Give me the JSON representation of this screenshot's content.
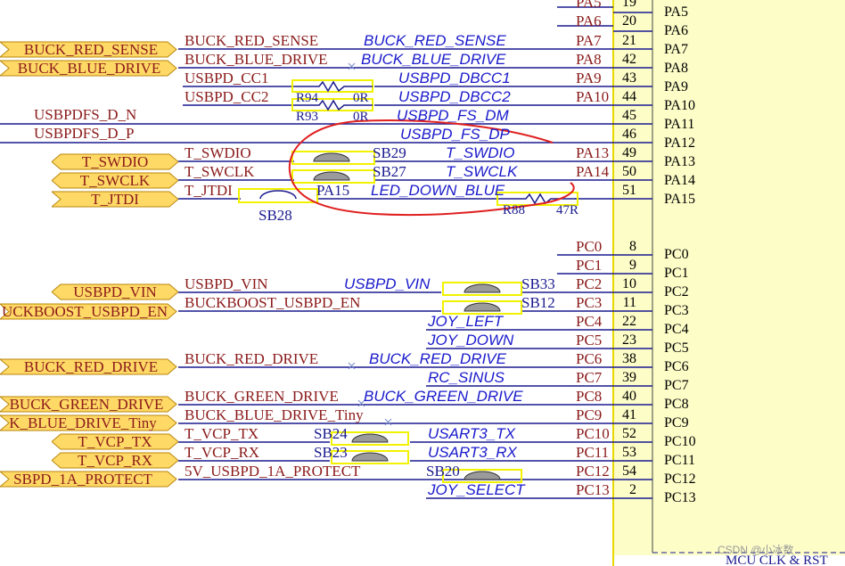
{
  "colors": {
    "wire": "#1a1a8f",
    "label_red": "#8b1a1a",
    "port_fill": "#ffd966",
    "port_stroke": "#b8860b",
    "ic_fill": "#fdfdc8",
    "ic_border": "#b8860b",
    "highlight": "#f2f200",
    "annotation": "#e02020"
  },
  "ports": [
    {
      "label": "BUCK_RED_SENSE"
    },
    {
      "label": "BUCK_BLUE_DRIVE"
    },
    {
      "label": "T_SWDIO"
    },
    {
      "label": "T_SWCLK"
    },
    {
      "label": "T_JTDI"
    },
    {
      "label": "USBPD_VIN"
    },
    {
      "label": "UCKBOOST_USBPD_EN"
    },
    {
      "label": "BUCK_RED_DRIVE"
    },
    {
      "label": "BUCK_GREEN_DRIVE"
    },
    {
      "label": "K_BLUE_DRIVE_Tiny"
    },
    {
      "label": "T_VCP_TX"
    },
    {
      "label": "T_VCP_RX"
    },
    {
      "label": "SBPD_1A_PROTECT"
    }
  ],
  "plain_labels": [
    {
      "text": "USBPDFS_D_N"
    },
    {
      "text": "USBPDFS_D_P"
    }
  ],
  "wire_labels": [
    {
      "text": "BUCK_RED_SENSE"
    },
    {
      "text": "BUCK_BLUE_DRIVE"
    },
    {
      "text": "USBPD_CC1"
    },
    {
      "text": "USBPD_CC2"
    },
    {
      "text": "T_SWDIO"
    },
    {
      "text": "T_SWCLK"
    },
    {
      "text": "T_JTDI"
    },
    {
      "text": "USBPD_VIN"
    },
    {
      "text": "BUCKBOOST_USBPD_EN"
    },
    {
      "text": "BUCK_RED_DRIVE"
    },
    {
      "text": "BUCK_GREEN_DRIVE"
    },
    {
      "text": "BUCK_BLUE_DRIVE_Tiny"
    },
    {
      "text": "T_VCP_TX"
    },
    {
      "text": "T_VCP_RX"
    },
    {
      "text": "5V_USBPD_1A_PROTECT"
    }
  ],
  "net_labels": [
    {
      "text": "BUCK_RED_SENSE"
    },
    {
      "text": "BUCK_BLUE_DRIVE"
    },
    {
      "text": "USBPD_DBCC1"
    },
    {
      "text": "USBPD_DBCC2"
    },
    {
      "text": "USBPD_FS_DM"
    },
    {
      "text": "USBPD_FS_DP"
    },
    {
      "text": "T_SWDIO"
    },
    {
      "text": "T_SWCLK"
    },
    {
      "text": "LED_DOWN_BLUE"
    },
    {
      "text": "USBPD_VIN"
    },
    {
      "text": "JOY_LEFT"
    },
    {
      "text": "JOY_DOWN"
    },
    {
      "text": "BUCK_RED_DRIVE"
    },
    {
      "text": "RC_SINUS"
    },
    {
      "text": "BUCK_GREEN_DRIVE"
    },
    {
      "text": "USART3_TX"
    },
    {
      "text": "USART3_RX"
    },
    {
      "text": "JOY_SELECT"
    }
  ],
  "components": [
    {
      "ref": "R94",
      "value": "0R"
    },
    {
      "ref": "R93",
      "value": "0R"
    },
    {
      "ref": "SB29"
    },
    {
      "ref": "SB27"
    },
    {
      "ref": "PA15"
    },
    {
      "ref": "SB28"
    },
    {
      "ref": "R88",
      "value": "47R"
    },
    {
      "ref": "SB33"
    },
    {
      "ref": "SB12"
    },
    {
      "ref": "SB24"
    },
    {
      "ref": "SB23"
    },
    {
      "ref": "SB20"
    }
  ],
  "pin_nets": [
    "PA5",
    "PA6",
    "PA7",
    "PA8",
    "PA9",
    "PA10",
    "PA13",
    "PA14",
    "PC0",
    "PC1",
    "PC2",
    "PC3",
    "PC4",
    "PC5",
    "PC6",
    "PC7",
    "PC8",
    "PC9",
    "PC10",
    "PC11",
    "PC12",
    "PC13"
  ],
  "pin_numbers": [
    "19",
    "20",
    "21",
    "42",
    "43",
    "44",
    "45",
    "46",
    "49",
    "50",
    "51",
    "8",
    "9",
    "10",
    "11",
    "22",
    "23",
    "38",
    "39",
    "40",
    "41",
    "52",
    "53",
    "54",
    "2"
  ],
  "ic_pins": [
    "PA5",
    "PA6",
    "PA7",
    "PA8",
    "PA9",
    "PA10",
    "PA11",
    "PA12",
    "PA13",
    "PA14",
    "PA15",
    "PC0",
    "PC1",
    "PC2",
    "PC3",
    "PC4",
    "PC5",
    "PC6",
    "PC7",
    "PC8",
    "PC9",
    "PC10",
    "PC11",
    "PC12",
    "PC13"
  ],
  "footer": {
    "block_label": "MCU CLK & RST"
  },
  "watermark": "CSDN @小冰数"
}
